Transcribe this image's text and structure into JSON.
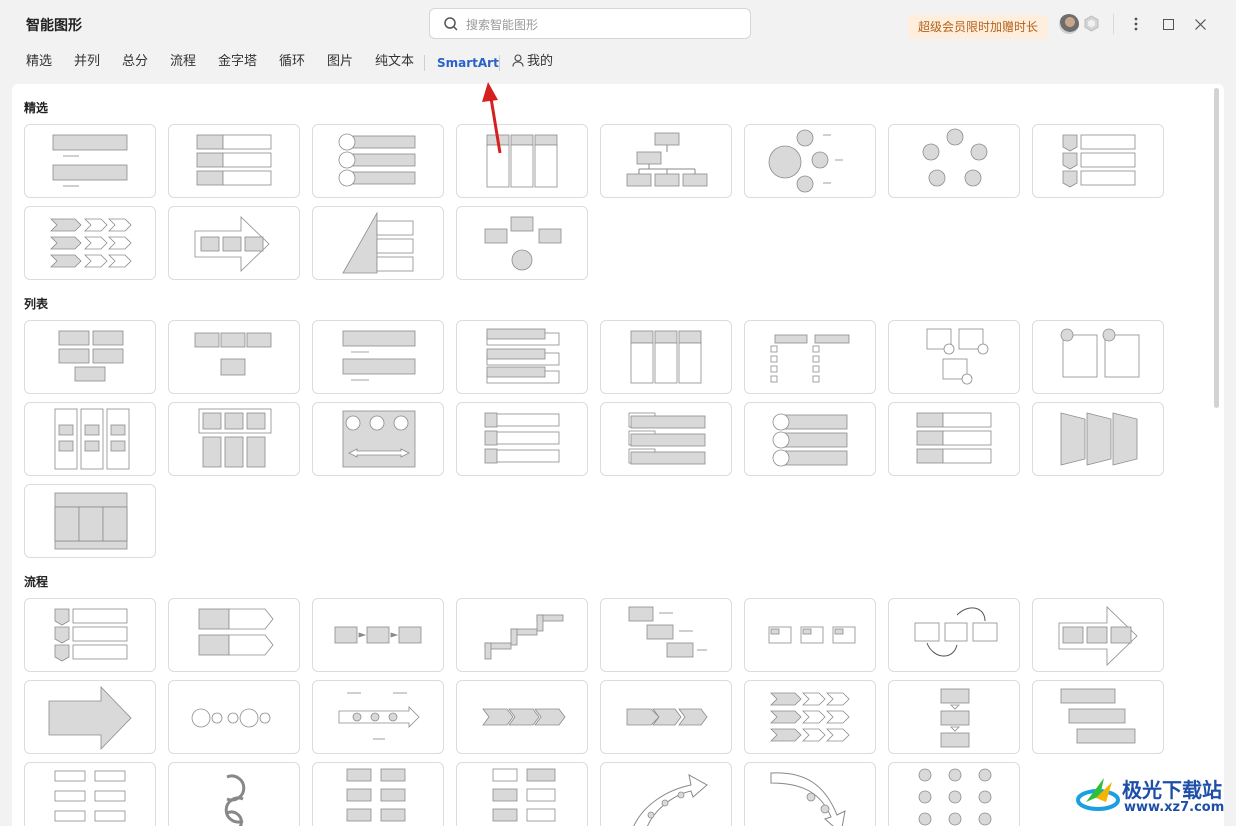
{
  "window": {
    "title": "智能图形",
    "search_placeholder": "搜索智能图形",
    "vip_label": "超级会员限时加赠时长",
    "controls": [
      "more-icon",
      "maximize-icon",
      "close-icon"
    ]
  },
  "tabs": [
    {
      "label": "精选"
    },
    {
      "label": "并列"
    },
    {
      "label": "总分"
    },
    {
      "label": "流程"
    },
    {
      "label": "金字塔"
    },
    {
      "label": "循环"
    },
    {
      "label": "图片"
    },
    {
      "label": "纯文本"
    },
    {
      "label": "SmartArt",
      "active": true
    },
    {
      "label": "我的"
    }
  ],
  "sections": [
    {
      "title": "精选",
      "templates": [
        "list-boxes",
        "bullet-rows",
        "circle-bars",
        "columns",
        "org-chart",
        "radial-circles",
        "cycle",
        "chevron-list",
        "chevron-process",
        "arrow-process",
        "pyramid-list",
        "converging"
      ]
    },
    {
      "title": "列表",
      "templates": [
        "block-grid",
        "grouped-list",
        "horizontal-bullets",
        "stacked-tabs",
        "column-list",
        "checklist",
        "picture-cards",
        "picture-frames",
        "tile-columns",
        "table-list",
        "picture-strip",
        "tab-list",
        "bullet-bars",
        "circle-list",
        "label-list",
        "trapezoid-list",
        "table-hierarchy"
      ]
    },
    {
      "title": "流程",
      "templates": [
        "chevron-steps",
        "arrow-bullets",
        "basic-process",
        "staircase",
        "bending-process",
        "box-process",
        "cycle-process",
        "arrow-boxes",
        "big-arrow",
        "circle-timeline",
        "timeline-arrow",
        "chevron-row",
        "pentagon-row",
        "chevron-lists",
        "vertical-process",
        "stair-down",
        "grid-process",
        "circular-arrows",
        "snake-process",
        "branch-process",
        "curved-arrow",
        "down-arrow",
        "circle-grid"
      ]
    }
  ],
  "colors": {
    "accent": "#2a62c9",
    "shape_fill": "#d9d9d9",
    "shape_stroke": "#8c8c8c",
    "annotation_arrow": "#d62020"
  },
  "watermark": {
    "text": "极光下载站",
    "url": "www.xz7.com"
  }
}
